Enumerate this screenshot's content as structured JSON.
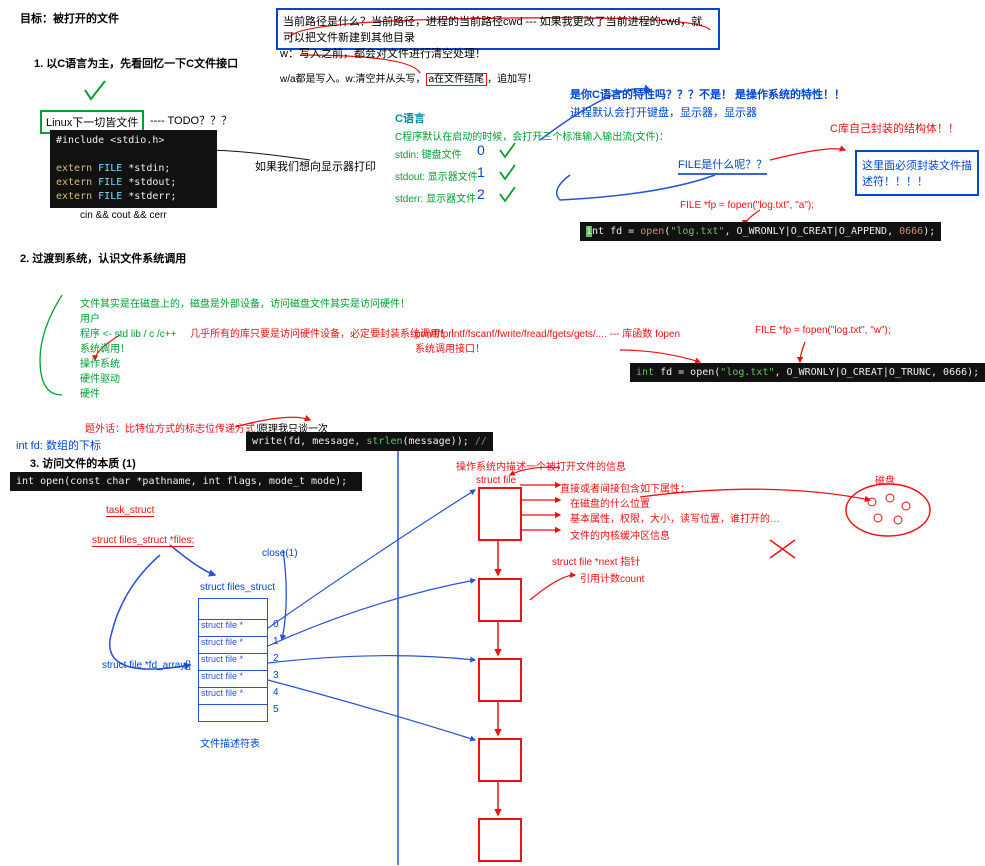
{
  "header": {
    "goal": "目标：被打开的文件",
    "sec1": "1. 以C语言为主，先看回忆一下C文件接口",
    "q1": "当前路径是什么？当前路径，进程的当前路径cwd --- 如果我更改了当前进程的cwd，就可以把文件新建到其他目录",
    "note_w": "w：写入之前，都会对文件进行清空处理！",
    "note_wa": "w/a都是写入。w:清空并从头写，a在文件结尾，追加写！"
  },
  "s1": {
    "linux_box": "Linux下一切皆文件",
    "todo": "---- TODO？？？",
    "code": "#include <stdio.h>\n\nextern FILE *stdin;\nextern FILE *stdout;\nextern FILE *stderr;",
    "cpp": "cin && cout && cerr",
    "note": "如果我们想向显示器打印",
    "cyan_title": "C语言",
    "cyan_desc": "C程序默认在启动的时候，会打开三个标准输入输出流(文件)：",
    "sin": "stdin: 键盘文件",
    "sout": "stdout: 显示器文件",
    "serr": "stderr: 显示器文件",
    "n0": "0",
    "n1": "1",
    "n2": "2",
    "q_blue": "是你C语言的特性吗？？？不是！ 是操作系统的特性！！",
    "q_blue2": "进程默认会打开键盘，显示器，显示器",
    "file_q": "FILE是什么呢？？",
    "file_r": "C库自己封装的结构体！！",
    "file_box": "这里面必须封装文件描述符！！！！",
    "fopen_a": "FILE *fp = fopen(\"log.txt\", \"a\");",
    "open_a": "int fd = open(\"log.txt\", O_WRONLY|O_CREAT|O_APPEND, 0666);"
  },
  "s2": {
    "title": "2. 过渡到系统，认识文件系统调用",
    "ln1": "文件其实是在磁盘上的，磁盘是外部设备，访问磁盘文件其实是访问硬件！",
    "ln2": "用户",
    "ln3": "程序 <- std lib / c /c++",
    "ln4": "系统调用！",
    "ln5": "操作系统",
    "ln6": "硬件驱动",
    "ln7": "硬件",
    "red1": "几乎所有的库只要是访问硬件设备，必定要封装系统调用！！",
    "red2": "printf/fprintf/fscanf/fwrite/fread/fgets/gets/.... --- 库函数  fopen",
    "red3": "系统调用接口！",
    "fopen_w": "FILE *fp = fopen(\"log.txt\", \"w\");",
    "open_w": "int fd = open(\"log.txt\", O_WRONLY|O_CREAT|O_TRUNC, 0666);"
  },
  "s3": {
    "ext": "题外话：比特位方式的标志位传递方式！",
    "ext2": "原理我只谈一次",
    "intfd": "int fd:  数组的下标",
    "title": "3. 访问文件的本质   (1)",
    "sig": "int open(const char *pathname, int flags, mode_t mode);",
    "write": "write(fd, message, strlen(message)); //",
    "ts": "task_struct",
    "fs": "struct files_struct *files;",
    "close": "close(1)",
    "sfs": "struct files_struct",
    "fda": "struct file *fd_array[]",
    "fdt": "文件描述符表",
    "sf": "struct file *",
    "idx": [
      "0",
      "1",
      "2",
      "3",
      "4",
      "5"
    ],
    "kern": "操作系统内描述一个被打开文件的信息",
    "sfile": "struct file",
    "a1": "直接或者间接包含如下属性：",
    "a2": "在磁盘的什么位置",
    "a3": "基本属性，权限，大小，读写位置，谁打开的…",
    "a4": "文件的内核缓冲区信息",
    "next": "struct file *next 指针",
    "cnt": "引用计数count",
    "disk": "磁盘"
  }
}
